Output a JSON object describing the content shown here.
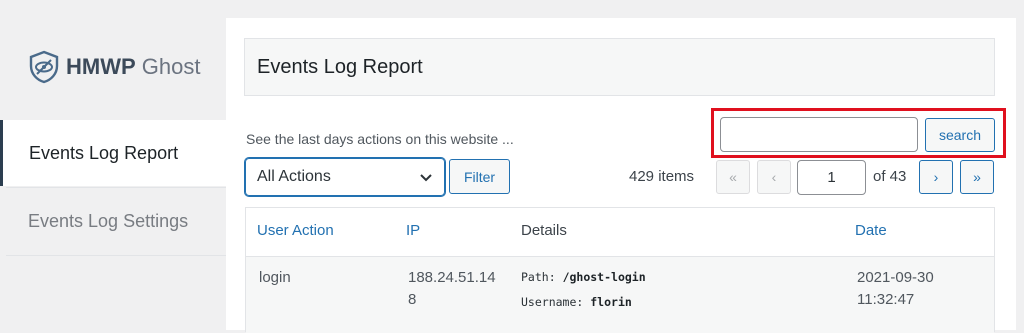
{
  "sidebar": {
    "logo": {
      "brand": "HMWP",
      "product": "Ghost"
    },
    "items": [
      {
        "label": "Events Log Report",
        "active": true
      },
      {
        "label": "Events Log Settings",
        "active": false
      }
    ]
  },
  "main": {
    "title": "Events Log Report",
    "description": "See the last days actions on this website ...",
    "search": {
      "value": "",
      "placeholder": "",
      "button_label": "search"
    },
    "filter": {
      "selected": "All Actions",
      "button_label": "Filter"
    },
    "pagination": {
      "items_text": "429 items",
      "first": "«",
      "prev": "‹",
      "current_page": "1",
      "of_text": "of 43",
      "next": "›",
      "last": "»"
    },
    "table": {
      "columns": [
        "User Action",
        "IP",
        "Details",
        "Date"
      ],
      "rows": [
        {
          "action": "login",
          "ip_line1": "188.24.51.14",
          "ip_line2": "8",
          "path_label": "Path:",
          "path_value": "/ghost-login",
          "user_label": "Username:",
          "user_value": "florin",
          "date": "2021-09-30",
          "time": "11:32:47"
        }
      ]
    }
  },
  "colors": {
    "accent": "#2271b1",
    "highlight": "#e0101e",
    "background": "#f0f0f1"
  }
}
